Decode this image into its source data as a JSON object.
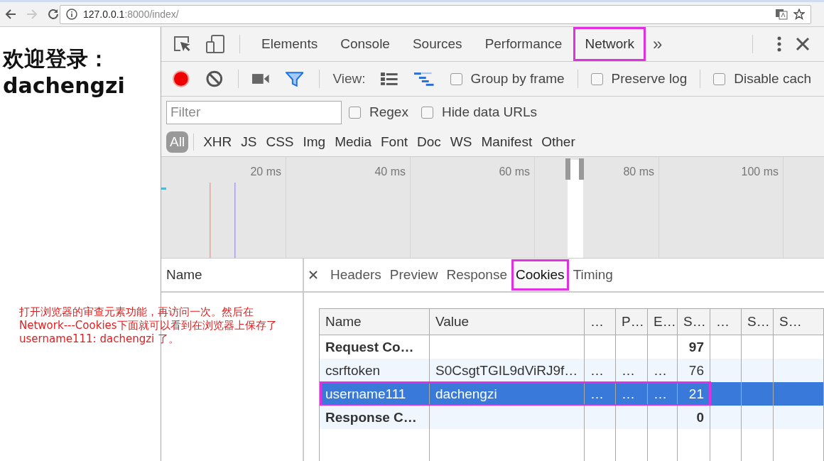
{
  "browser": {
    "back_enabled": true,
    "forward_enabled": false,
    "url_host": "127.0.0.1",
    "url_rest": ":8000/index/"
  },
  "page": {
    "heading": "欢迎登录：",
    "username": "dachengzi"
  },
  "annotation": {
    "text": "打开浏览器的审查元素功能，再访问一次。然后在\nNetwork---Cookies下面就可以看到在浏览器上保存了\nusername111: dachengzi 了。"
  },
  "devtools": {
    "tabs": [
      {
        "label": "Elements",
        "selected": false,
        "highlighted": false
      },
      {
        "label": "Console",
        "selected": false,
        "highlighted": false
      },
      {
        "label": "Sources",
        "selected": false,
        "highlighted": false
      },
      {
        "label": "Performance",
        "selected": false,
        "highlighted": false
      },
      {
        "label": "Network",
        "selected": true,
        "highlighted": true
      }
    ],
    "more_tabs": "»",
    "toolbar": {
      "recording": true,
      "view_label": "View:",
      "large_rows": false,
      "overview": true,
      "options": [
        {
          "label": "Group by frame",
          "checked": false
        },
        {
          "label": "Preserve log",
          "checked": false
        },
        {
          "label": "Disable cach",
          "checked": false
        }
      ]
    },
    "filter": {
      "placeholder": "Filter",
      "options": [
        {
          "label": "Regex",
          "checked": false
        },
        {
          "label": "Hide data URLs",
          "checked": false
        }
      ]
    },
    "types": [
      {
        "label": "All",
        "selected": true
      },
      {
        "label": "XHR",
        "selected": false
      },
      {
        "label": "JS",
        "selected": false
      },
      {
        "label": "CSS",
        "selected": false
      },
      {
        "label": "Img",
        "selected": false
      },
      {
        "label": "Media",
        "selected": false
      },
      {
        "label": "Font",
        "selected": false
      },
      {
        "label": "Doc",
        "selected": false
      },
      {
        "label": "WS",
        "selected": false
      },
      {
        "label": "Manifest",
        "selected": false
      },
      {
        "label": "Other",
        "selected": false
      }
    ],
    "overview_ticks": [
      "20 ms",
      "40 ms",
      "60 ms",
      "80 ms",
      "100 ms"
    ],
    "name_header": "Name",
    "detail_tabs": [
      {
        "label": "Headers",
        "selected": false,
        "highlighted": false
      },
      {
        "label": "Preview",
        "selected": false,
        "highlighted": false
      },
      {
        "label": "Response",
        "selected": false,
        "highlighted": false
      },
      {
        "label": "Cookies",
        "selected": true,
        "highlighted": true
      },
      {
        "label": "Timing",
        "selected": false,
        "highlighted": false
      }
    ],
    "cookies": {
      "columns": [
        "Name",
        "Value",
        "…",
        "P…",
        "E…",
        "S…",
        "…",
        "S…",
        "S…"
      ],
      "rows": [
        {
          "kind": "group",
          "selected": false,
          "highlighted": false,
          "cells": [
            "Request Co…",
            null,
            null,
            null,
            null,
            "97",
            null,
            null,
            null
          ]
        },
        {
          "kind": "cookie",
          "selected": false,
          "highlighted": false,
          "cells": [
            "csrftoken",
            "S0CsgtTGIL9dViRJ9f…",
            "…",
            "…",
            "…",
            "76",
            null,
            null,
            null
          ]
        },
        {
          "kind": "cookie",
          "selected": true,
          "highlighted": true,
          "cells": [
            "username111",
            "dachengzi",
            "…",
            "…",
            "…",
            "21",
            null,
            null,
            null
          ]
        },
        {
          "kind": "group",
          "selected": false,
          "highlighted": false,
          "cells": [
            "Response C…",
            null,
            null,
            null,
            null,
            "0",
            null,
            null,
            null
          ]
        }
      ]
    }
  }
}
